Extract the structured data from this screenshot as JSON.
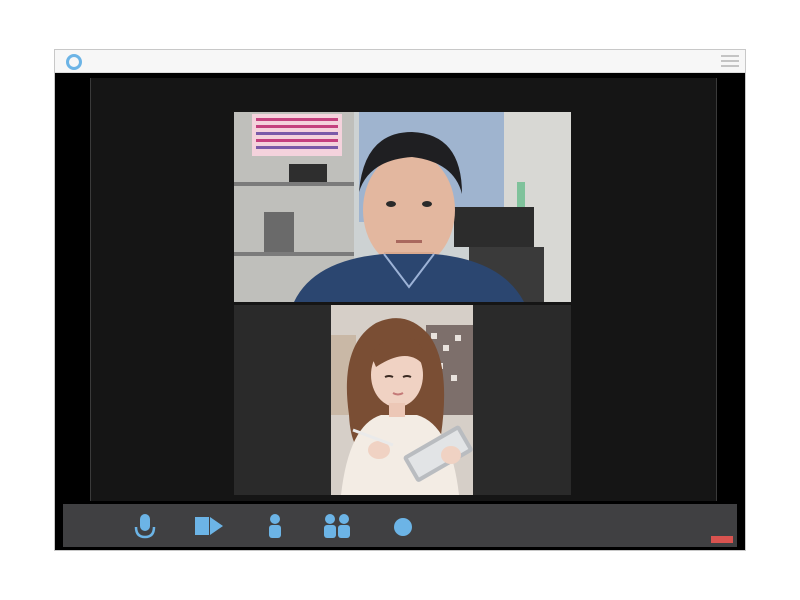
{
  "window": {
    "accent_color": "#6cb4e6",
    "logo_icon": "ring-logo-icon",
    "menu_icon": "hamburger-menu-icon"
  },
  "participants": [
    {
      "id": "participant-1"
    },
    {
      "id": "participant-2"
    }
  ],
  "controls": [
    {
      "icon": "microphone-icon"
    },
    {
      "icon": "video-camera-icon"
    },
    {
      "icon": "single-person-icon"
    },
    {
      "icon": "group-people-icon"
    },
    {
      "icon": "record-dot-icon"
    }
  ],
  "leave_button": {
    "color": "#d9534f"
  }
}
